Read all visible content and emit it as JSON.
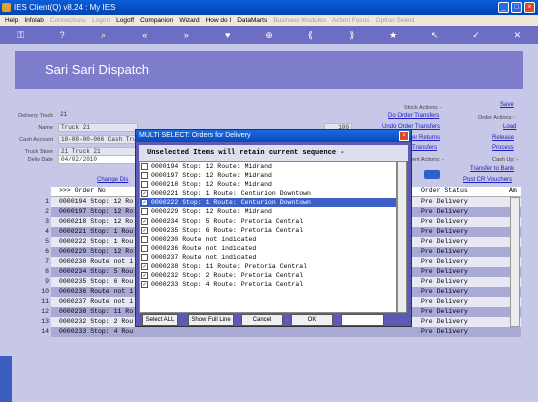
{
  "window": {
    "title": "IES Client(Q) v8.24 : My IES"
  },
  "menu": [
    "Help",
    "Infolab",
    "Connections",
    "Logon",
    "Logoff",
    "Companion",
    "Wizard",
    "How do I",
    "DataMarts",
    "Business Modules",
    "Action Focus",
    "Option Select"
  ],
  "menu_disabled": [
    false,
    false,
    true,
    true,
    false,
    false,
    false,
    false,
    false,
    true,
    true,
    true
  ],
  "header": {
    "title": "Sari Sari Dispatch"
  },
  "form": {
    "delivery_truck_label": "Delivery Truck",
    "delivery_truck": "21",
    "name_label": "Name",
    "name": "Truck 21",
    "cash_account_label": "Cash Account",
    "cash_account": "18-08-00-066 Cash Truck",
    "truck_store_label": "Truck Store",
    "truck_store": "21 Truck 21",
    "deliv_date_label": "Deliv Date",
    "deliv_date": "04/02/2010",
    "change_link": "Change Dis",
    "qty": "100"
  },
  "right": {
    "save": "Save",
    "stock_actions": "Stock Actions: -",
    "do_order_transfers": "Do Order Transfers",
    "undo_order_transfers": "Undo Order Transfers",
    "returns": "er Returns",
    "transfers": "Transfers",
    "order_actions": "Order Actions: -",
    "load": "Load",
    "release": "Release",
    "process": "Process",
    "print_actions": "ent Actions: -",
    "cash_up": "Cash Up: -",
    "transfer_to_bank": "Transfer to Bank",
    "post_cr_vouchers": "Post CR Vouchers"
  },
  "table": {
    "col_order": ">>> Order No",
    "col_status": "Order Status",
    "col_amt": "Am",
    "rows": [
      {
        "n": "1",
        "order": "0000194 Stop: 12 Ro",
        "status": "Pre Delivery"
      },
      {
        "n": "2",
        "order": "0000197 Stop: 12 Ro",
        "status": "Pre Delivery"
      },
      {
        "n": "3",
        "order": "0000218 Stop: 12 Ro",
        "status": "Pre Delivery"
      },
      {
        "n": "4",
        "order": "0000221 Stop: 1 Rou",
        "status": "Pre Delivery"
      },
      {
        "n": "5",
        "order": "0000222 Stop: 1 Rou",
        "status": "Pre Delivery"
      },
      {
        "n": "6",
        "order": "0000229 Stop: 12 Ro",
        "status": "Pre Delivery"
      },
      {
        "n": "7",
        "order": "0000230 Route not i",
        "status": "Pre Delivery"
      },
      {
        "n": "8",
        "order": "0000234 Stop: 5 Rou",
        "status": "Pre Delivery"
      },
      {
        "n": "9",
        "order": "0000235 Stop: 6 Rou",
        "status": "Pre Delivery"
      },
      {
        "n": "10",
        "order": "0000236 Route not i",
        "status": "Pre Delivery"
      },
      {
        "n": "11",
        "order": "0000237 Route not i",
        "status": "Pre Delivery"
      },
      {
        "n": "12",
        "order": "0000238 Stop: 11 Ro",
        "status": "Pre Delivery"
      },
      {
        "n": "13",
        "order": "0000232 Stop: 2 Rou",
        "status": "Pre Delivery"
      },
      {
        "n": "14",
        "order": "0000233 Stop: 4 Rou",
        "status": "Pre Delivery"
      }
    ]
  },
  "dialog": {
    "title": "MULTI SELECT: Orders for Delivery",
    "header": "Unselected Items will retain current sequence -",
    "items": [
      {
        "text": "0000194 Stop: 12 Route: Midrand",
        "checked": false,
        "selected": false
      },
      {
        "text": "0000197 Stop: 12 Route: Midrand",
        "checked": false,
        "selected": false
      },
      {
        "text": "0000218 Stop: 12 Route: Midrand",
        "checked": false,
        "selected": false
      },
      {
        "text": "0000221 Stop: 1 Route: Centurion Downtown",
        "checked": true,
        "selected": false
      },
      {
        "text": "0000222 Stop: 1 Route: Centurion Downtown",
        "checked": true,
        "selected": true
      },
      {
        "text": "0000229 Stop: 12 Route: Midrand",
        "checked": false,
        "selected": false
      },
      {
        "text": "0000234 Stop: 5 Route: Pretoria Central",
        "checked": true,
        "selected": false
      },
      {
        "text": "0000235 Stop: 6 Route: Pretoria Central",
        "checked": true,
        "selected": false
      },
      {
        "text": "0000230 Route not indicated",
        "checked": false,
        "selected": false
      },
      {
        "text": "0000236 Route not indicated",
        "checked": false,
        "selected": false
      },
      {
        "text": "0000237 Route not indicated",
        "checked": false,
        "selected": false
      },
      {
        "text": "0000238 Stop: 11 Route: Pretoria Central",
        "checked": true,
        "selected": false
      },
      {
        "text": "0000232 Stop: 2 Route: Pretoria Central",
        "checked": true,
        "selected": false
      },
      {
        "text": "0000233 Stop: 4 Route: Pretoria Central",
        "checked": true,
        "selected": false
      }
    ],
    "select_all": "Select ALL",
    "show_full_line": "Show Full Line",
    "cancel": "Cancel",
    "ok": "OK"
  }
}
